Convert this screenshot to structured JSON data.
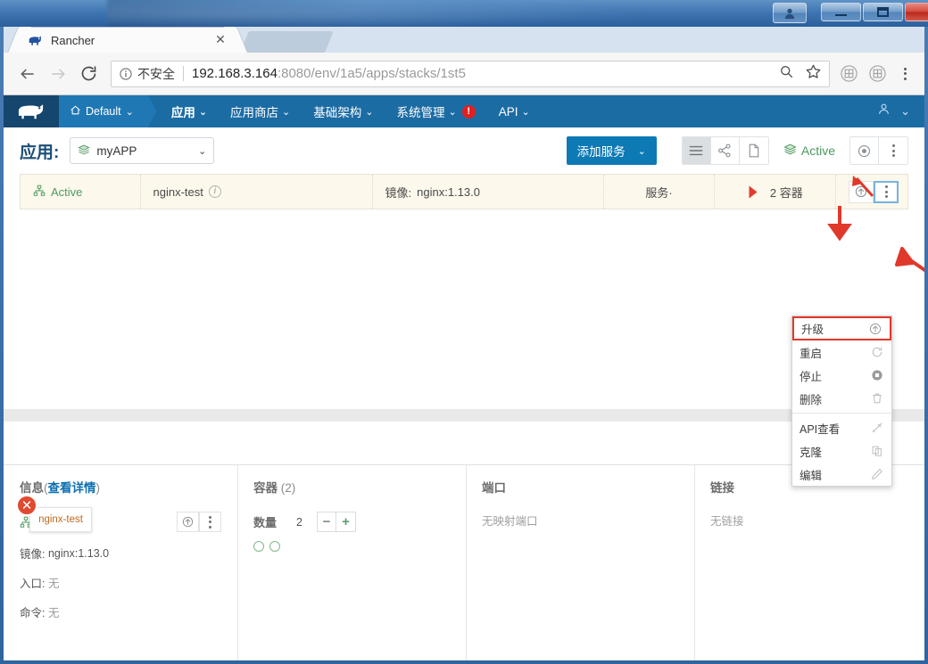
{
  "window": {
    "minimize_label": "—",
    "maximize_label": "❐",
    "close_label": "✕",
    "user_icon": "user-account-icon"
  },
  "browser": {
    "tab": {
      "title": "Rancher",
      "close_label": "✕",
      "favicon": "rancher-cow-favicon"
    },
    "nav": {
      "back": "←",
      "forward": "→",
      "reload": "⟳"
    },
    "omnibox": {
      "security_icon": "info-circle-icon",
      "security_label": "不安全",
      "url_host": "192.168.3.164",
      "url_path": ":8080/env/1a5/apps/stacks/1st5",
      "zoom_icon": "search-icon",
      "bookmark_icon": "star-icon"
    },
    "extensions": [
      "extension-icon-1",
      "extension-icon-2"
    ],
    "menu_icon": "chrome-menu-icon"
  },
  "rancher_nav": {
    "logo": "rancher-cow-logo",
    "environment": {
      "icon": "home-icon",
      "label": "Default",
      "caret": "⌄"
    },
    "items": [
      {
        "label": "应用",
        "caret": "⌄",
        "active": true
      },
      {
        "label": "应用商店",
        "caret": "⌄",
        "active": false
      },
      {
        "label": "基础架构",
        "caret": "⌄",
        "active": false
      },
      {
        "label": "系统管理",
        "caret": "⌄",
        "active": false,
        "badge": "!"
      },
      {
        "label": "API",
        "caret": "⌄",
        "active": false
      }
    ],
    "account_icon": "user-icon",
    "account_caret": "⌄"
  },
  "app_header": {
    "title": "应用:",
    "stack_icon": "stack-icon",
    "stack_name": "myAPP",
    "stack_caret": "⌄",
    "add_service_label": "添加服务",
    "add_service_caret": "⌄",
    "views": [
      {
        "name": "list-view",
        "icon": "list-icon",
        "active": true
      },
      {
        "name": "graph-view",
        "icon": "share-graph-icon",
        "active": false
      },
      {
        "name": "file-view",
        "icon": "document-icon",
        "active": false
      }
    ],
    "state_icon": "stack-icon",
    "state_label": "Active",
    "actions": [
      {
        "name": "stack-circle-action",
        "icon": "circle-dot-icon"
      },
      {
        "name": "stack-menu-action",
        "icon": "kebab-menu-icon"
      }
    ]
  },
  "service_row": {
    "state_icon": "service-icon",
    "state": "Active",
    "name": "nginx-test",
    "name_info_icon": "info-icon",
    "image_label": "镜像:",
    "image_value": "nginx:1.13.0",
    "type": "服务·",
    "scale_marker": "triangle-marker",
    "scale": "2 容器",
    "actions": [
      {
        "name": "upgrade-arrow-button",
        "icon": "arrow-up-circle-icon",
        "pressed": false
      },
      {
        "name": "row-menu-button",
        "icon": "kebab-menu-icon",
        "pressed": true
      }
    ]
  },
  "dropdown_menu": {
    "items": [
      {
        "label": "升级",
        "icon": "arrow-up-circle-icon",
        "highlighted": true
      },
      {
        "label": "重启",
        "icon": "restart-icon",
        "highlighted": false
      },
      {
        "label": "停止",
        "icon": "stop-circle-icon",
        "highlighted": false
      },
      {
        "label": "删除",
        "icon": "trash-icon",
        "highlighted": false
      },
      {
        "separator": true
      },
      {
        "label": "API查看",
        "icon": "api-wrench-icon",
        "highlighted": false
      },
      {
        "label": "克隆",
        "icon": "copy-icon",
        "highlighted": false
      },
      {
        "label": "编辑",
        "icon": "pencil-icon",
        "highlighted": false
      }
    ]
  },
  "canvas": {
    "node_badge_icon": "error-close-icon",
    "node_tooltip": "nginx-test"
  },
  "detail": {
    "info": {
      "heading_main": "信息",
      "heading_paren_open": "(",
      "heading_link": "查看详情",
      "heading_paren_close": ")",
      "state_icon": "service-icon",
      "state": "Active",
      "actions": [
        {
          "name": "detail-upgrade-button",
          "icon": "arrow-up-circle-icon"
        },
        {
          "name": "detail-menu-button",
          "icon": "kebab-menu-icon"
        }
      ],
      "image_label": "镜像:",
      "image_value": "nginx:1.13.0",
      "entry_label": "入口:",
      "entry_value": "无",
      "command_label": "命令:",
      "command_value": "无"
    },
    "containers": {
      "heading_main": "容器",
      "heading_count": "(2)",
      "scale_label": "数量",
      "scale_value": "2",
      "minus_label": "−",
      "plus_label": "+",
      "dots": [
        "container-dot-1",
        "container-dot-2"
      ]
    },
    "ports": {
      "heading": "端口",
      "empty": "无映射端口"
    },
    "links": {
      "heading": "链接",
      "empty": "无链接"
    }
  },
  "colors": {
    "rancher_nav": "#1c6ca4",
    "rancher_logo_bg": "#14466e",
    "primary_button": "#0d7ab5",
    "active_green": "#4c9a5e",
    "row_bg": "#fcf8ec",
    "annotation_red": "#e0392c",
    "badge_red": "#e02020"
  }
}
